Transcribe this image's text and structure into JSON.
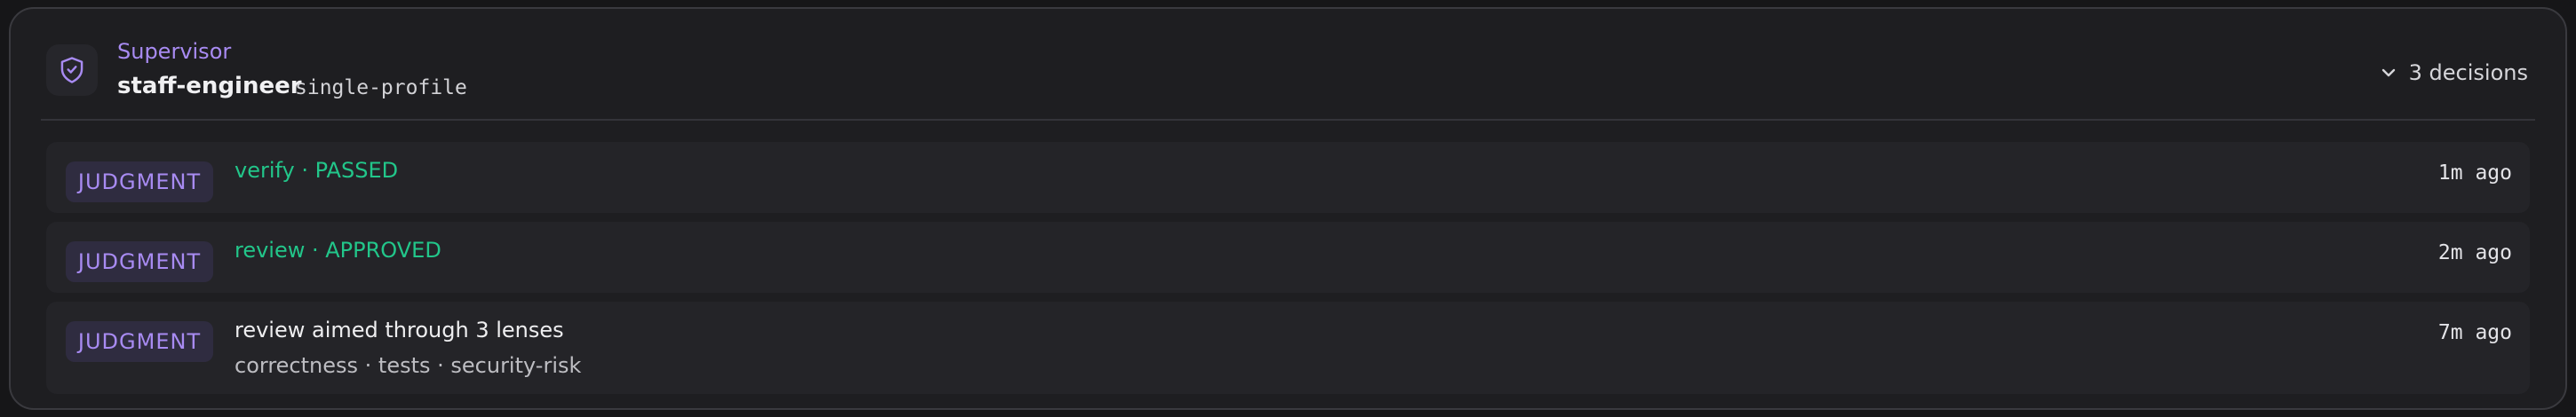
{
  "header": {
    "icon": "shield-check-icon",
    "role": "Supervisor",
    "name": "staff-engineer",
    "profile": "single-profile",
    "toggle_icon": "chevron-down-icon",
    "decisions_count": "3 decisions"
  },
  "decisions": [
    {
      "badge": "JUDGMENT",
      "title": "verify · PASSED",
      "time": "1m ago"
    },
    {
      "badge": "JUDGMENT",
      "title": "review · APPROVED",
      "time": "2m ago"
    },
    {
      "badge": "JUDGMENT",
      "title": "review aimed through 3 lenses",
      "subtitle": "correctness · tests · security-risk",
      "time": "7m ago"
    }
  ],
  "colors": {
    "accent": "#a88bf2",
    "success": "#22c68a",
    "background": "#1e1e21"
  }
}
